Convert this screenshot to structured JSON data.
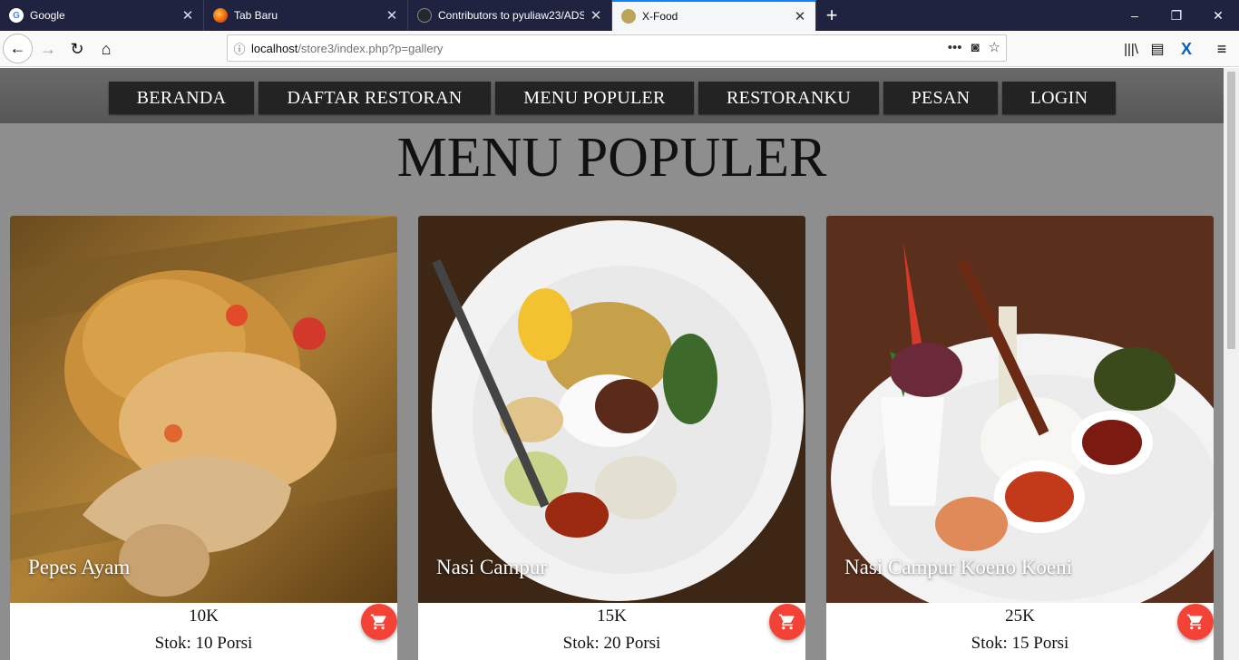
{
  "browser": {
    "tabs": [
      {
        "title": "Google",
        "icon": "google-icon"
      },
      {
        "title": "Tab Baru",
        "icon": "firefox-icon"
      },
      {
        "title": "Contributors to pyuliaw23/ADS",
        "icon": "github-icon"
      },
      {
        "title": "X-Food",
        "icon": "xfood-icon",
        "active": true
      }
    ],
    "url_host": "localhost",
    "url_path": "/store3/index.php?p=gallery",
    "ui_colors": {
      "tabstrip": "#202340",
      "accent": "#0a84ff"
    }
  },
  "site": {
    "nav": [
      "BERANDA",
      "DAFTAR RESTORAN",
      "MENU POPULER",
      "RESTORANKU",
      "PESAN",
      "LOGIN"
    ],
    "title": "MENU POPULER",
    "colors": {
      "page_bg": "#8e8e8e",
      "nav_btn": "#232323",
      "cart_btn": "#f44336"
    }
  },
  "products": [
    {
      "name": "Pepes Ayam",
      "price": "10K",
      "stock": "Stok: 10 Porsi",
      "icon": "cart-icon"
    },
    {
      "name": "Nasi Campur",
      "price": "15K",
      "stock": "Stok: 20 Porsi",
      "icon": "cart-icon"
    },
    {
      "name": "Nasi Campur Koeno Koeni",
      "price": "25K",
      "stock": "Stok: 15 Porsi",
      "icon": "cart-icon"
    }
  ]
}
